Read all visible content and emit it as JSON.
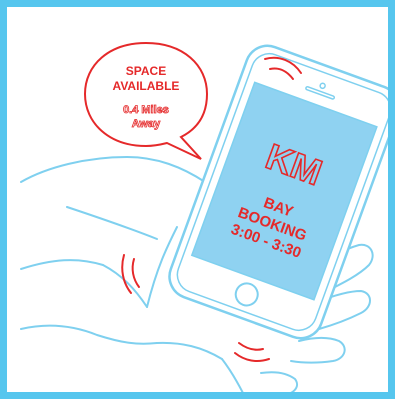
{
  "bubble": {
    "line1": "SPACE",
    "line2": "AVAILABLE",
    "distance_line1": "0.4 Miles",
    "distance_line2": "Away"
  },
  "screen": {
    "logo": "KM",
    "line1": "BAY",
    "line2": "BOOKING",
    "line3": "3:00 - 3:30"
  },
  "colors": {
    "frame": "#56c6ee",
    "outline": "#7fd0ef",
    "screen": "#8fd2f1",
    "accent": "#e5292a"
  }
}
